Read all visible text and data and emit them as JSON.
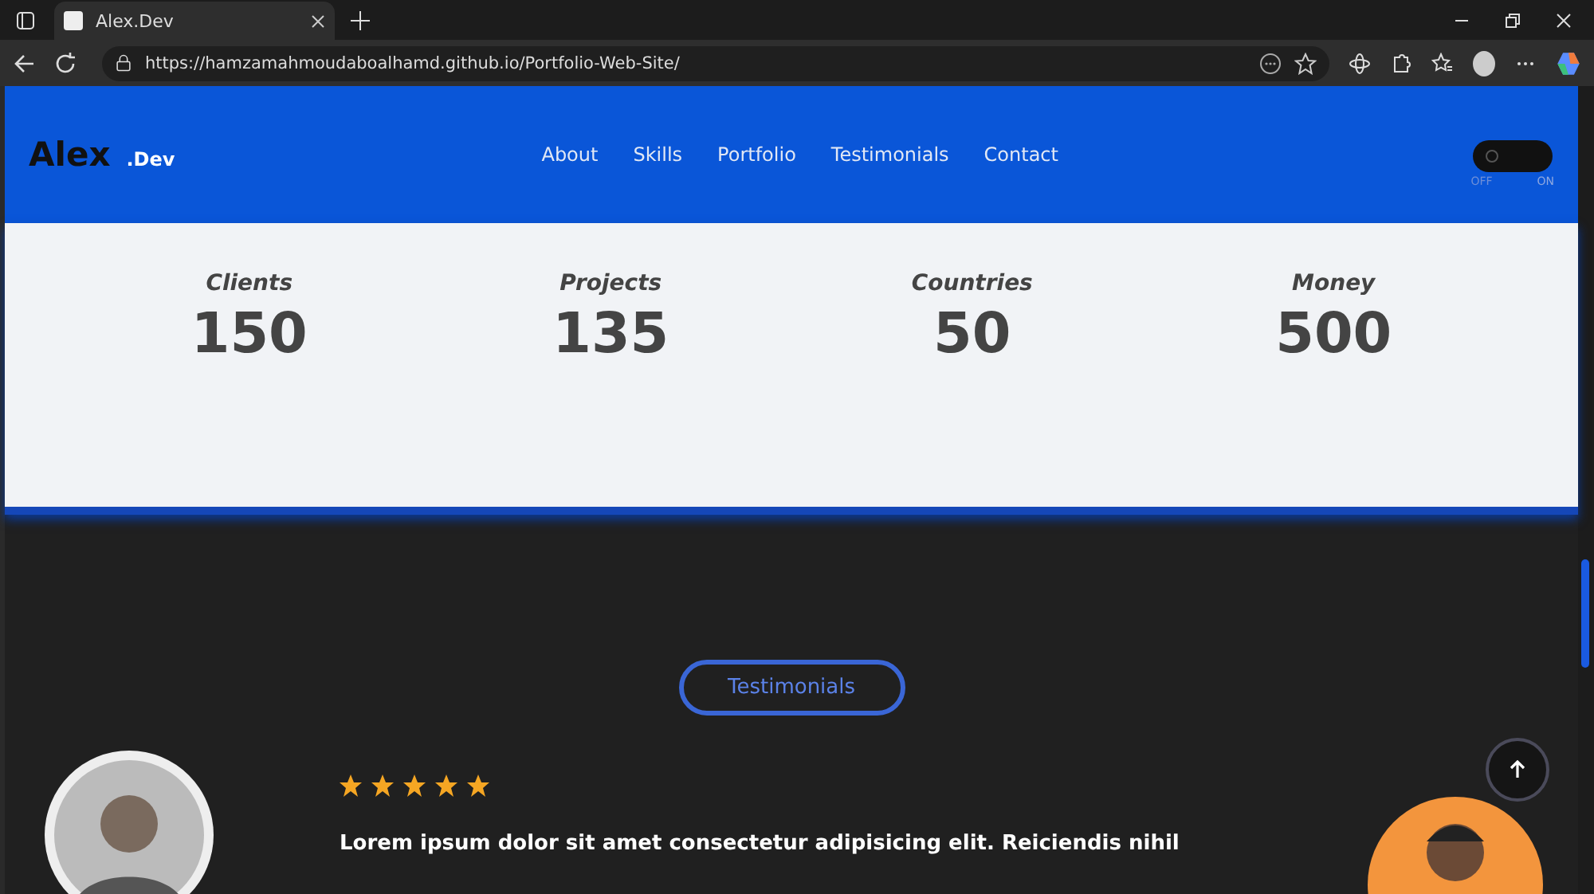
{
  "browser": {
    "tab_title": "Alex.Dev",
    "url": "https://hamzamahmoudaboalhamd.github.io/Portfolio-Web-Site/"
  },
  "header": {
    "logo": "Alex",
    "logo_suffix": ".Dev",
    "nav": [
      {
        "label": "About"
      },
      {
        "label": "Skills"
      },
      {
        "label": "Portfolio"
      },
      {
        "label": "Testimonials"
      },
      {
        "label": "Contact"
      }
    ],
    "theme_toggle": {
      "on": false,
      "off_label": "OFF",
      "on_label": "ON"
    }
  },
  "stats": [
    {
      "label": "Clients",
      "value": "150"
    },
    {
      "label": "Projects",
      "value": "135"
    },
    {
      "label": "Countries",
      "value": "50"
    },
    {
      "label": "Money",
      "value": "500"
    }
  ],
  "testimonials": {
    "heading": "Testimonials",
    "stars": 5,
    "quote": "Lorem ipsum dolor sit amet consectetur adipisicing elit. Reiciendis nihil"
  }
}
